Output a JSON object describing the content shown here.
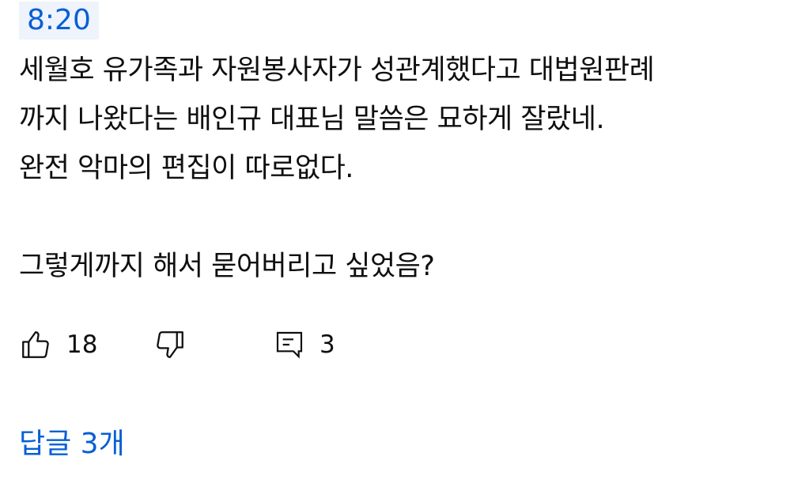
{
  "comment": {
    "timestamp": "8:20",
    "text": "세월호 유가족과 자원봉사자가 성관계했다고 대법원판례\n까지 나왔다는 배인규 대표님 말씀은 묘하게 잘랐네.\n완전 악마의 편집이 따로없다.\n\n그렇게까지 해서 묻어버리고 싶었음?",
    "like_count": "18",
    "reply_count": "3",
    "replies_link": "답글 3개"
  },
  "icons": {
    "like": "thumbs-up-icon",
    "dislike": "thumbs-down-icon",
    "reply": "comment-icon"
  },
  "colors": {
    "accent": "#065fd4",
    "timestamp_bg": "#eef3fc",
    "text": "#0f0f0f"
  }
}
